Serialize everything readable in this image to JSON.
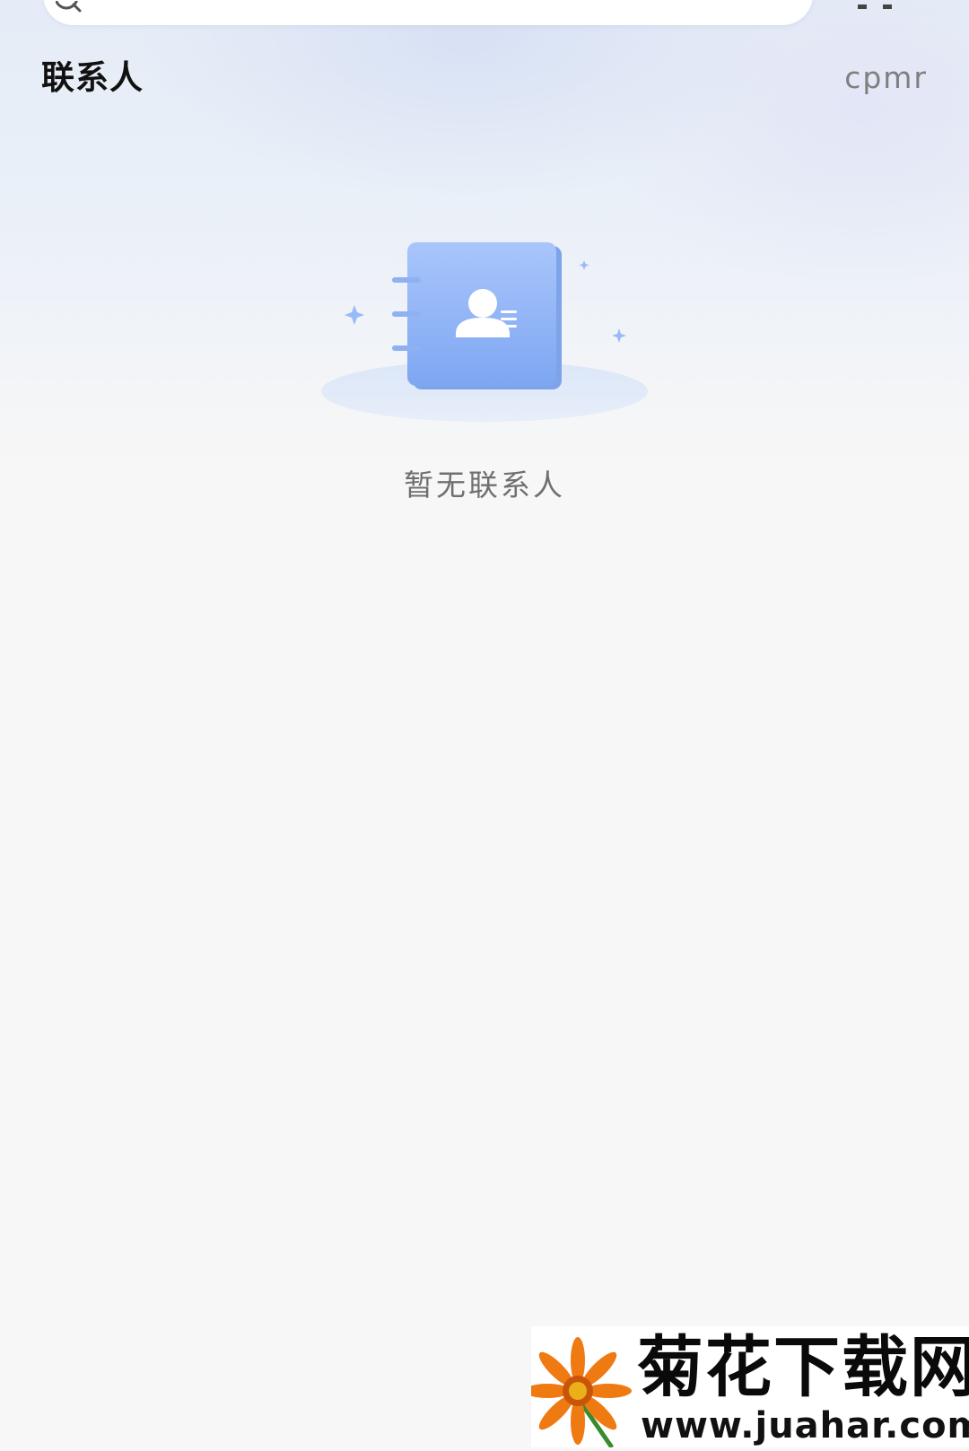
{
  "header": {
    "title": "联系人",
    "action_label": "cpmr"
  },
  "empty_state": {
    "message": "暂无联系人",
    "icon": "contact-book-icon"
  },
  "search": {
    "icon": "search-icon"
  },
  "watermark": {
    "title": "菊花下载网",
    "url": "www.juahar.com"
  },
  "colors": {
    "accent_blue": "#8fb3f7",
    "title_text": "#111111",
    "secondary_text": "#7f7f7f",
    "background": "#f7f7f7"
  }
}
